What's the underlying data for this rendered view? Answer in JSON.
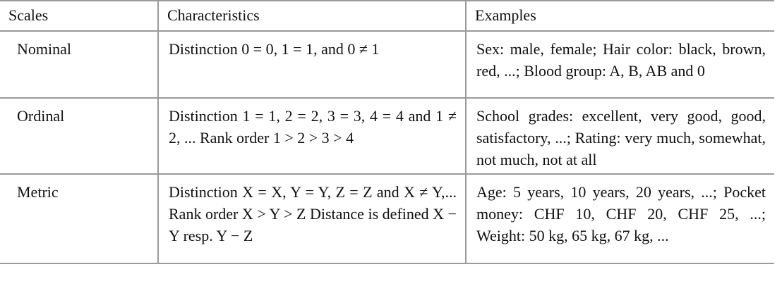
{
  "table": {
    "headers": [
      "Scales",
      "Characteristics",
      "Examples"
    ],
    "rows": [
      {
        "scale": "Nominal",
        "characteristics": "Distinction 0 = 0, 1 = 1, and 0 ≠ 1",
        "examples": "Sex: male, female; Hair color: black, brown, red, ...; Blood group: A, B, AB and 0"
      },
      {
        "scale": "Ordinal",
        "characteristics": "Distinction 1 = 1, 2 = 2, 3 = 3, 4 = 4 and 1 ≠ 2, ... Rank order 1 > 2 > 3 > 4",
        "examples": "School grades: excellent, very good, good, satisfactory, ...; Rating: very much, somewhat, not much, not at all"
      },
      {
        "scale": "Metric",
        "characteristics": "Distinction X = X, Y = Y, Z = Z and X ≠ Y,... Rank order X > Y > Z Distance is defined X − Y resp. Y − Z",
        "examples": "Age: 5 years, 10 years, 20 years, ...; Pocket money: CHF 10, CHF 20, CHF 25, ...; Weight: 50 kg, 65 kg, 67 kg, ..."
      }
    ]
  }
}
